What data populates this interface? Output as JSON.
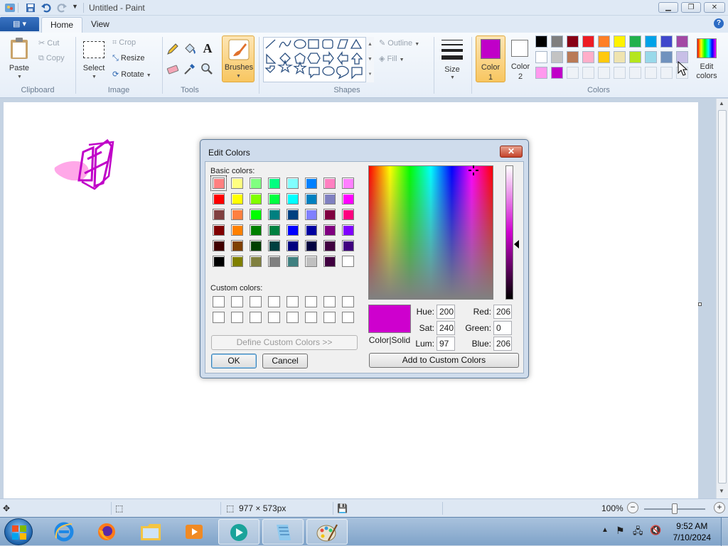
{
  "window": {
    "title": "Untitled - Paint"
  },
  "tabs": {
    "file": "▤ ▾",
    "home": "Home",
    "view": "View"
  },
  "help": "?",
  "clipboard": {
    "paste": "Paste",
    "cut": "Cut",
    "copy": "Copy",
    "group": "Clipboard"
  },
  "image": {
    "select": "Select",
    "crop": "Crop",
    "resize": "Resize",
    "rotate": "Rotate",
    "group": "Image"
  },
  "tools": {
    "group": "Tools"
  },
  "brushes": {
    "label": "Brushes"
  },
  "shapes": {
    "outline": "Outline",
    "fill": "Fill",
    "group": "Shapes"
  },
  "size": {
    "label": "Size"
  },
  "color1": {
    "label": "Color",
    "num": "1",
    "value": "#c000c8"
  },
  "color2": {
    "label": "Color",
    "num": "2",
    "value": "#ffffff"
  },
  "colors_group": "Colors",
  "edit_colors": {
    "line1": "Edit",
    "line2": "colors"
  },
  "palette": [
    [
      "#000000",
      "#7f7f7f",
      "#880015",
      "#ed1c24",
      "#ff7f27",
      "#fff200",
      "#22b14c",
      "#00a2e8",
      "#3f48cc",
      "#a349a4"
    ],
    [
      "#ffffff",
      "#c3c3c3",
      "#b97a57",
      "#ffaec9",
      "#ffc90e",
      "#efe4b0",
      "#b5e61d",
      "#99d9ea",
      "#7092be",
      "#c8bfe7"
    ],
    [
      "#ff99ee",
      "#c000c8",
      "",
      "",
      "",
      "",
      "",
      "",
      "",
      ""
    ]
  ],
  "status": {
    "dimensions": "977 × 573px",
    "zoom": "100%"
  },
  "clock": {
    "time": "9:52 AM",
    "date": "7/10/2024"
  },
  "dialog": {
    "title": "Edit Colors",
    "close": "✕",
    "basic_label": "Basic colors:",
    "custom_label": "Custom colors:",
    "basic_colors": [
      [
        "#ff8080",
        "#ffff80",
        "#80ff80",
        "#00ff80",
        "#80ffff",
        "#0080ff",
        "#ff80c0",
        "#ff80ff"
      ],
      [
        "#ff0000",
        "#ffff00",
        "#80ff00",
        "#00ff40",
        "#00ffff",
        "#0080c0",
        "#8080c0",
        "#ff00ff"
      ],
      [
        "#804040",
        "#ff8040",
        "#00ff00",
        "#008080",
        "#004080",
        "#8080ff",
        "#800040",
        "#ff0080"
      ],
      [
        "#800000",
        "#ff8000",
        "#008000",
        "#008040",
        "#0000ff",
        "#0000a0",
        "#800080",
        "#8000ff"
      ],
      [
        "#400000",
        "#804000",
        "#004000",
        "#004040",
        "#000080",
        "#000040",
        "#400040",
        "#400080"
      ],
      [
        "#000000",
        "#808000",
        "#808040",
        "#808080",
        "#408080",
        "#c0c0c0",
        "#400040",
        "#ffffff"
      ]
    ],
    "define_custom": "Define Custom Colors >>",
    "ok": "OK",
    "cancel": "Cancel",
    "add_custom": "Add to Custom Colors",
    "color_solid": "Color|Solid",
    "preview_color": "#ce00ce",
    "hue_label": "Hue:",
    "hue": "200",
    "sat_label": "Sat:",
    "sat": "240",
    "lum_label": "Lum:",
    "lum": "97",
    "red_label": "Red:",
    "red": "206",
    "green_label": "Green:",
    "green": "0",
    "blue_label": "Blue:",
    "blue": "206"
  }
}
